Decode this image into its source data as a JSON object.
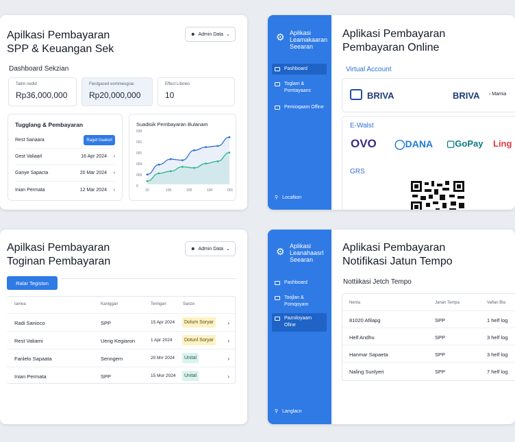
{
  "card1": {
    "title1": "Apilkasi Pembayaran",
    "title2": "SPP & Keuangan Sek",
    "admin": "Admin Data",
    "dashboard": "Dashboard Sekzian",
    "stats": [
      {
        "label": "Tatim nedid",
        "value": "Rp36,000,000"
      },
      {
        "label": "Fiestgaced eommeograc",
        "value": "Rp20,000,000"
      },
      {
        "label": "Effect Libmes",
        "value": "10"
      }
    ],
    "list_title": "Tugglang & Pembayaran",
    "list_button": "Raget traaksrl",
    "list": [
      {
        "name": "Rest Sanaara",
        "date": ""
      },
      {
        "name": "Gest Valiaarl",
        "date": "16 Apr 2024"
      },
      {
        "name": "Ganye Sapacta",
        "date": "20 Mar 2024"
      },
      {
        "name": "Inian Permata",
        "date": "12 Mar 2024"
      }
    ],
    "chart_title": "Suadisik Pembayaran Bulanam"
  },
  "chart_data": {
    "type": "line",
    "title": "Suadisik Pembayaran Bulanam",
    "y_ticks": [
      "030",
      "001",
      "001",
      "004",
      "003",
      "0"
    ],
    "x_ticks": [
      "10",
      "100",
      "100",
      "100",
      "001"
    ],
    "series": [
      {
        "values": [
          0.9,
          1.8,
          2.3,
          2.2,
          3.1,
          3.4,
          3.5,
          4.3
        ]
      },
      {
        "values": [
          0.3,
          1.0,
          1.2,
          1.6,
          1.5,
          1.9,
          2.1,
          2.9
        ]
      }
    ],
    "ylim": [
      0,
      5
    ],
    "colors": [
      "#2f6fd1",
      "#2bb58a"
    ]
  },
  "card2": {
    "app_title": "Aplikasi Leamakaaran Seearan",
    "nav": [
      {
        "label": "Pashboard",
        "active": true
      },
      {
        "label": "Toglam & Pomtayaans",
        "active": false
      },
      {
        "label": "Pemioqaam Offine",
        "active": false
      }
    ],
    "location": "Localtion",
    "title1": "Aplikasi Pembayaran",
    "title2": "Pembayaran Online",
    "va_label": "Virtual Account",
    "briva": "BRIVA",
    "briva2": "BRIVA",
    "mami": "Mamia",
    "ewallet_label": "E-Walst",
    "wallets": [
      "OVO",
      "DANA",
      "GoPay",
      "Ling"
    ],
    "qr_label": "GRS"
  },
  "card3": {
    "title1": "Apilkasi Pembayaran",
    "title2": "Toginan Pembayaran",
    "admin": "Admin Data",
    "button": "Ralar Tegiston",
    "headers": [
      "Iamea",
      "Kaniggari",
      "Temigari",
      "Sanze"
    ],
    "rows": [
      {
        "name": "Radi Sanioco",
        "cat": "SPP",
        "date": "15 Apr 2024",
        "status": "Dolum Soryar",
        "tone": "y"
      },
      {
        "name": "Rest Valiami",
        "cat": "Ueng Kegiaron",
        "date": "1 Apr 2024",
        "status": "Dotunl Soryar",
        "tone": "y"
      },
      {
        "name": "Fanlelo Sapaata",
        "cat": "Senngem",
        "date": "20 Mrr 2024",
        "status": "Unital",
        "tone": "g"
      },
      {
        "name": "Inian Permata",
        "cat": "SPP",
        "date": "15 Mor 2024",
        "status": "Unital",
        "tone": "g"
      }
    ]
  },
  "card4": {
    "app_title": "Aplikasi Leanahaasrl Seearan",
    "nav": [
      {
        "label": "Pashboard",
        "active": false
      },
      {
        "label": "Toojlan & Pomqoyam",
        "active": false
      },
      {
        "label": "Pazniloyaam Ofine",
        "active": true
      }
    ],
    "location": "Langlacn",
    "title1": "Aplikasi Pembayaran",
    "title2": "Notifikasi Jatun Tempo",
    "sub": "Nottiikasi Jetch Tempo",
    "headers": [
      "Nenta",
      "Janan Tempa",
      "Vaflan Bla"
    ],
    "rows": [
      {
        "name": "81020 Afilapg",
        "cat": "SPP",
        "note": "1 helf log"
      },
      {
        "name": "Helf Andhu",
        "cat": "SPP",
        "note": "3 helf log"
      },
      {
        "name": "Hanmar Sapaeta",
        "cat": "SPP",
        "note": "3 helf log"
      },
      {
        "name": "Naling Sunlyeri",
        "cat": "SPP",
        "note": "7 helf log"
      }
    ]
  }
}
